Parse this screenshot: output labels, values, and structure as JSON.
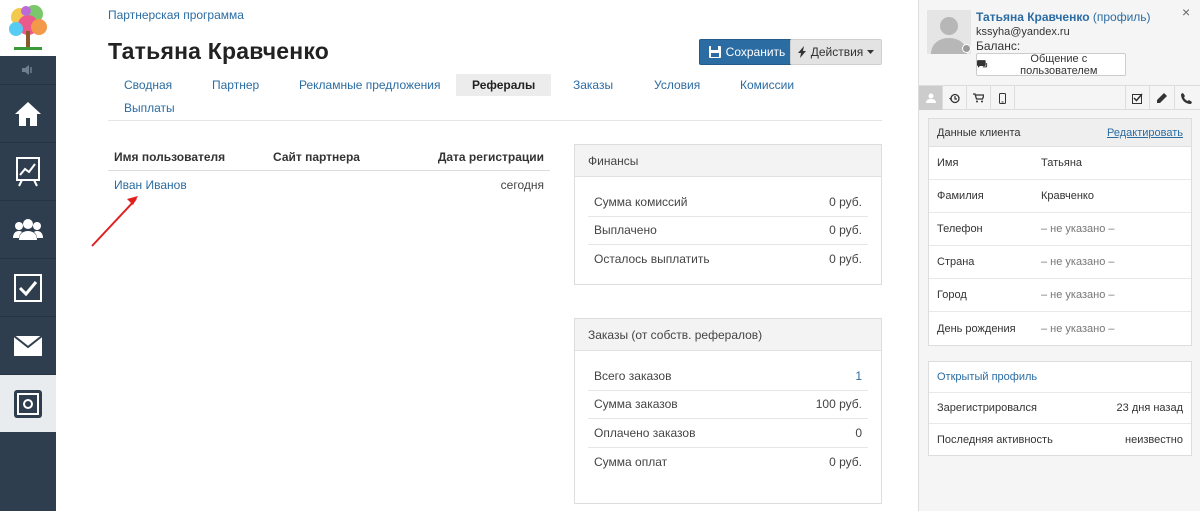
{
  "nav": {
    "items": [
      {
        "name": "home-icon"
      },
      {
        "name": "chart-icon"
      },
      {
        "name": "users-icon"
      },
      {
        "name": "tasks-icon"
      },
      {
        "name": "mail-icon"
      },
      {
        "name": "safe-icon"
      }
    ],
    "collapse_icon": "speaker-icon"
  },
  "breadcrumb": "Партнерская программа",
  "title": "Татьяна Кравченко",
  "buttons": {
    "save": "Сохранить",
    "actions": "Действия"
  },
  "tabs": [
    {
      "label": "Сводная",
      "active": false
    },
    {
      "label": "Партнер",
      "active": false
    },
    {
      "label": "Рекламные предложения",
      "active": false
    },
    {
      "label": "Рефералы",
      "active": true
    },
    {
      "label": "Заказы",
      "active": false
    },
    {
      "label": "Условия",
      "active": false
    },
    {
      "label": "Комиссии",
      "active": false
    },
    {
      "label": "Выплаты",
      "active": false
    }
  ],
  "referrals": {
    "headers": [
      "Имя пользователя",
      "Сайт партнера",
      "Дата регистрации"
    ],
    "rows": [
      {
        "user": "Иван Иванов",
        "site": "",
        "date": "сегодня"
      }
    ]
  },
  "finance": {
    "title": "Финансы",
    "rows": [
      {
        "label": "Сумма комиссий",
        "value": "0 руб."
      },
      {
        "label": "Выплачено",
        "value": "0 руб."
      },
      {
        "label": "Осталось выплатить",
        "value": "0 руб."
      }
    ]
  },
  "orders": {
    "title": "Заказы (от собств. рефералов)",
    "rows": [
      {
        "label": "Всего заказов",
        "value": "1"
      },
      {
        "label": "Сумма заказов",
        "value": "100 руб."
      },
      {
        "label": "Оплачено заказов",
        "value": "0"
      },
      {
        "label": "Сумма оплат",
        "value": "0 руб."
      }
    ]
  },
  "sidebar": {
    "name": "Татьяна Кравченко",
    "profile_link": "(профиль)",
    "email": "kssyha@yandex.ru",
    "balance": "Баланс:",
    "chat_button": "Общение с пользователем",
    "close": "×",
    "client_card": {
      "title": "Данные клиента",
      "edit": "Редактировать",
      "rows": [
        {
          "label": "Имя",
          "value": "Татьяна"
        },
        {
          "label": "Фамилия",
          "value": "Кравченко"
        },
        {
          "label": "Телефон",
          "value": "– не указано –"
        },
        {
          "label": "Страна",
          "value": "– не указано –"
        },
        {
          "label": "Город",
          "value": "– не указано –"
        },
        {
          "label": "День рождения",
          "value": "– не указано –"
        }
      ]
    },
    "profile_card": {
      "title": "Открытый профиль",
      "rows": [
        {
          "label": "Зарегистрировался",
          "value": "23 дня назад"
        },
        {
          "label": "Последняя активность",
          "value": "неизвестно"
        }
      ]
    }
  },
  "colors": {
    "accent": "#2b6ca3",
    "nav_bg": "#2f3e4e",
    "arrow": "#e02020"
  }
}
